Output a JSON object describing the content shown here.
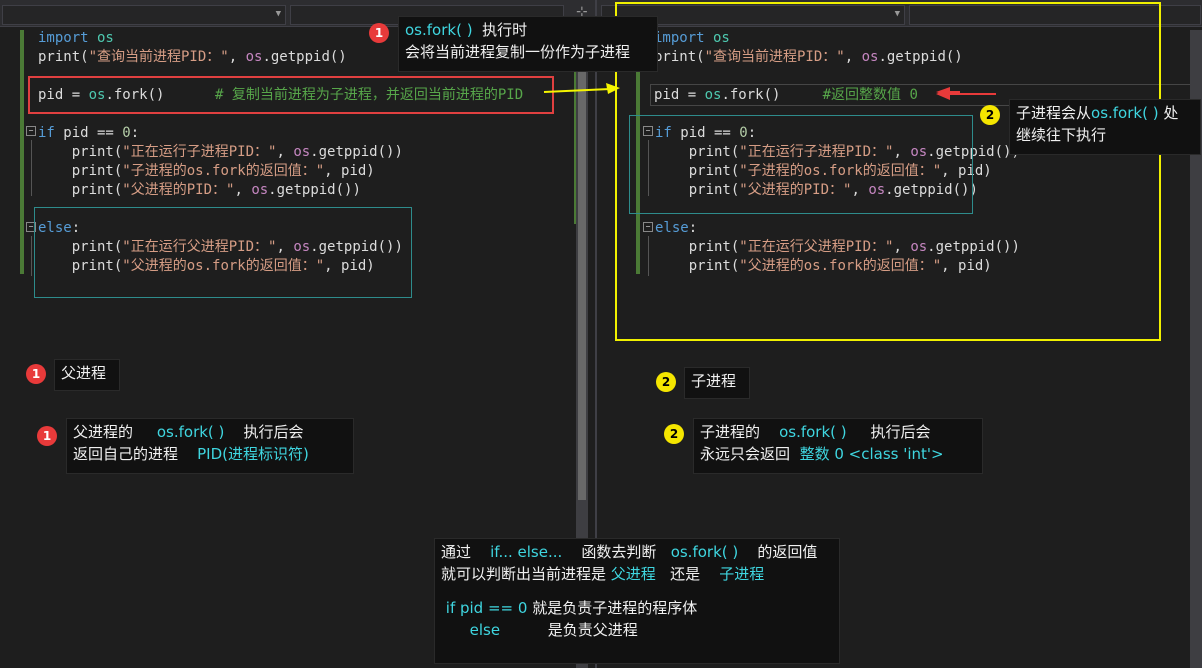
{
  "left_code": {
    "l1_kw": "import",
    "l1_mod": " os",
    "l2_fn": "print(",
    "l2_str": "\"查询当前进程PID：\"",
    "l2_sep": ", ",
    "l2_obj": "os",
    "l2_rest": ".getppid()",
    "l3_a": "pid = ",
    "l3_mod": "os",
    "l3_b": ".fork()",
    "l3_cmt": "      # 复制当前进程为子进程，并返回当前进程的PID",
    "l4_kw": "if",
    "l4_a": " pid == ",
    "l4_num": "0",
    "l4_b": ":",
    "l5_fn": "    print(",
    "l5_str": "\"正在运行子进程PID：\"",
    "l5_sep": ", ",
    "l5_obj": "os",
    "l5_rest": ".getppid())",
    "l6_fn": "    print(",
    "l6_str": "\"子进程的os.fork的返回值：\"",
    "l6_rest": ", pid)",
    "l7_fn": "    print(",
    "l7_str": "\"父进程的PID：\"",
    "l7_sep": ", ",
    "l7_obj": "os",
    "l7_rest": ".getppid())",
    "l8_kw": "else",
    "l8_b": ":",
    "l9_fn": "    print(",
    "l9_str": "\"正在运行父进程PID：\"",
    "l9_sep": ", ",
    "l9_obj": "os",
    "l9_rest": ".getppid())",
    "l10_fn": "    print(",
    "l10_str": "\"父进程的os.fork的返回值：\"",
    "l10_rest": ", pid)"
  },
  "right_code": {
    "l1_kw": "import",
    "l1_mod": " os",
    "l2_fn": "print(",
    "l2_str": "\"查询当前进程PID：\"",
    "l2_sep": ", ",
    "l2_obj": "os",
    "l2_rest": ".getppid()",
    "l3_a": "pid = ",
    "l3_mod": "os",
    "l3_b": ".fork()",
    "l3_cmt": "     #返回整数值 0",
    "l4_kw": "if",
    "l4_a": " pid == ",
    "l4_num": "0",
    "l4_b": ":",
    "l5_fn": "    print(",
    "l5_str": "\"正在运行子进程PID：\"",
    "l5_sep": ", ",
    "l5_obj": "os",
    "l5_rest": ".getppid())",
    "l6_fn": "    print(",
    "l6_str": "\"子进程的os.fork的返回值：\"",
    "l6_rest": ", pid)",
    "l7_fn": "    print(",
    "l7_str": "\"父进程的PID：\"",
    "l7_sep": ", ",
    "l7_obj": "os",
    "l7_rest": ".getppid())",
    "l8_kw": "else",
    "l8_b": ":",
    "l9_fn": "    print(",
    "l9_str": "\"正在运行父进程PID：\"",
    "l9_sep": ", ",
    "l9_obj": "os",
    "l9_rest": ".getppid())",
    "l10_fn": "    print(",
    "l10_str": "\"父进程的os.fork的返回值：\"",
    "l10_rest": ", pid)"
  },
  "badges": {
    "one": "1",
    "two": "2"
  },
  "notes": {
    "top_fork": "os.fork( )",
    "top_when": "执行时",
    "top_line2": "会将当前进程复制一份作为子进程",
    "child_from_a": "子进程会从",
    "child_from_fork": "os.fork( )",
    "child_from_b": "处",
    "child_from_line2": "继续往下执行",
    "parent_label": "父进程",
    "child_label": "子进程",
    "parent_ret_a": "父进程的",
    "parent_ret_fork": "os.fork( )",
    "parent_ret_b": "执行后会",
    "parent_ret_c": "返回自己的进程",
    "parent_ret_pid": "PID(进程标识符)",
    "child_ret_a": "子进程的",
    "child_ret_fork": "os.fork( )",
    "child_ret_b": "执行后会",
    "child_ret_c": "永远只会返回",
    "child_ret_val": "整数 0 <class 'int'>",
    "bottom_a": "通过",
    "bottom_ifelse": "if... else...",
    "bottom_b": "函数去判断",
    "bottom_fork": "os.fork( )",
    "bottom_c": "的返回值",
    "bottom_d": "就可以判断出当前进程是",
    "bottom_parent": "父进程",
    "bottom_e": "还是",
    "bottom_child": "子进程",
    "bottom_if": "if pid == 0",
    "bottom_f": "就是负责子进程的程序体",
    "bottom_else": "else",
    "bottom_g": "是负责父进程"
  },
  "colors": {
    "accent_cyan": "#3fd6e0",
    "red_badge": "#e83a3a",
    "yellow_badge": "#f5e600",
    "highlight_red": "#e04040",
    "highlight_yellow": "#f0f000"
  }
}
